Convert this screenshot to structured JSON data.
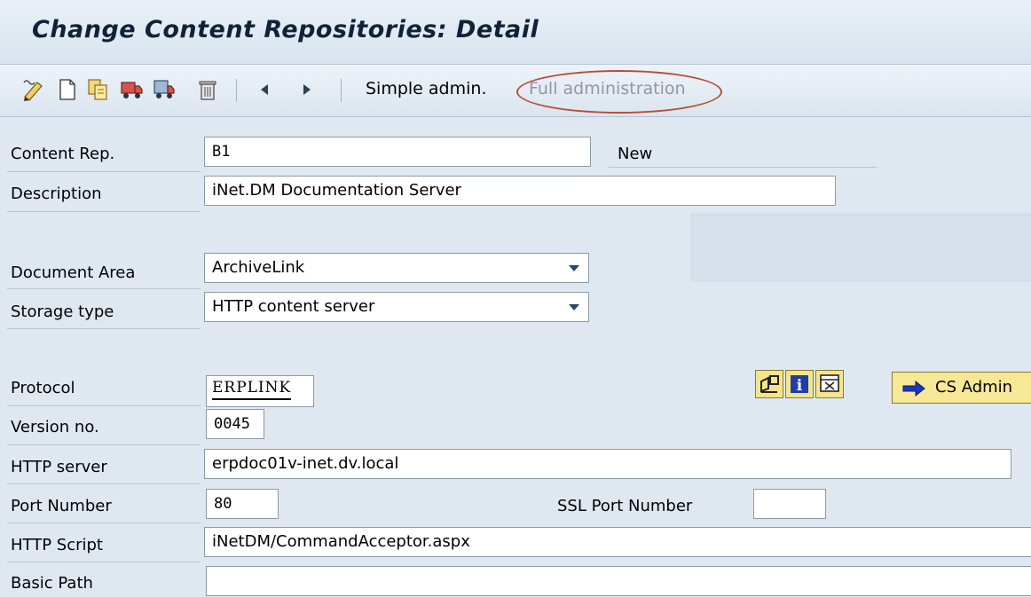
{
  "window": {
    "title": "Change Content Repositories: Detail"
  },
  "toolbar": {
    "icons": [
      "edit-pencil-icon",
      "new-document-icon",
      "copy-icon",
      "transport-icon",
      "delete-icon",
      "previous-icon",
      "next-icon"
    ],
    "simple_admin": "Simple admin.",
    "full_admin": "Full administration"
  },
  "form": {
    "content_rep": {
      "label": "Content Rep.",
      "value": "B1",
      "status": "New"
    },
    "description": {
      "label": "Description",
      "value": "iNet.DM Documentation Server"
    },
    "document_area": {
      "label": "Document Area",
      "value": "ArchiveLink"
    },
    "storage_type": {
      "label": "Storage type",
      "value": "HTTP content server"
    },
    "protocol": {
      "label": "Protocol",
      "value": "ERPLINK"
    },
    "version": {
      "label": "Version no.",
      "value": "0045"
    },
    "http_server": {
      "label": "HTTP server",
      "value": "erpdoc01v-inet.dv.local"
    },
    "port": {
      "label": "Port Number",
      "value": "80"
    },
    "ssl_port": {
      "label": "SSL Port Number",
      "value": ""
    },
    "http_script": {
      "label": "HTTP Script",
      "value": "iNetDM/CommandAcceptor.aspx"
    },
    "basic_path": {
      "label": "Basic Path",
      "value": ""
    },
    "cs_admin_button": "CS Admin"
  },
  "colors": {
    "background": "#dfe8f1",
    "highlight_oval": "#b84c39",
    "button_yellow": "#f6e896"
  }
}
